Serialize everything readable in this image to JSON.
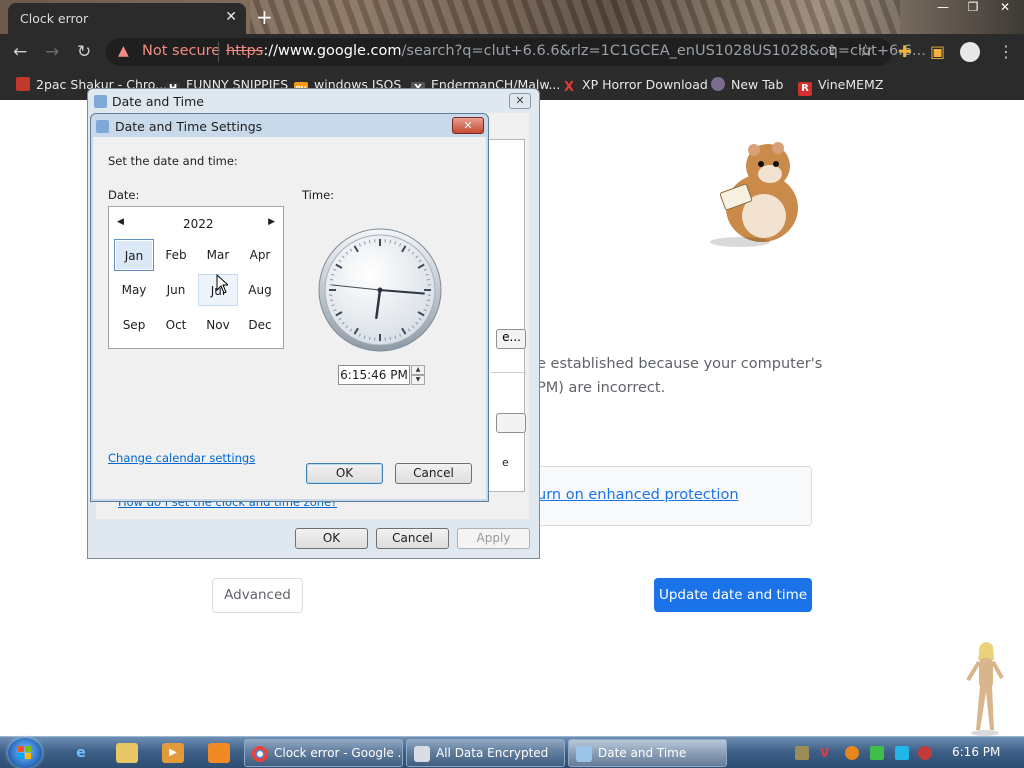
{
  "browser": {
    "tab_title": "Clock error",
    "tab_close": "✕",
    "newtab": "+",
    "window_controls": {
      "minimize": "—",
      "maximize": "❐",
      "close": "✕"
    },
    "security_warning": "Not secure",
    "url": {
      "scheme": "https",
      "host": "://www.google.com",
      "rest": "/search?q=clut+6.6.6&rlz=1C1GCEA_enUS1028US1028&oq=clut+6.6..."
    },
    "bookmarks": [
      {
        "label": "2pac Shakur - Chro...",
        "icon": "suitcase-icon",
        "color": "#c0392b",
        "glyph": ""
      },
      {
        "label": "FUNNY SNIPPIES",
        "icon": "h-icon",
        "color": "#333333",
        "glyph": "H"
      },
      {
        "label": "windows ISOS",
        "icon": "ph-icon",
        "color": "#f39c12",
        "glyph": "PH"
      },
      {
        "label": "EndermanCH/Malw...",
        "icon": "y-icon",
        "color": "#555555",
        "glyph": "Y"
      },
      {
        "label": "XP Horror Download",
        "icon": "x-icon",
        "color": "#e53935",
        "glyph": "X"
      },
      {
        "label": "New Tab",
        "icon": "globe-icon",
        "color": "#7b6b8f",
        "glyph": ""
      },
      {
        "label": "VineMEMZ",
        "icon": "r-icon",
        "color": "#d32f2f",
        "glyph": "R"
      }
    ]
  },
  "page": {
    "error_line1": "e established because your computer's",
    "error_line2": "PM) are incorrect.",
    "protection_link": "urn on enhanced protection",
    "advanced_button": "Advanced",
    "update_button": "Update date and time"
  },
  "outer_dialog": {
    "title": "Date and Time",
    "close": "✕",
    "stub_button_text": "e...",
    "stub_fragment": "e",
    "timezone_link": "How do I set the clock and time zone?",
    "ok": "OK",
    "cancel": "Cancel",
    "apply": "Apply"
  },
  "settings_dialog": {
    "title": "Date and Time Settings",
    "close": "✕",
    "instruction": "Set the date and time:",
    "date_label": "Date:",
    "time_label": "Time:",
    "calendar": {
      "prev": "◀",
      "next": "▶",
      "year": "2022",
      "months": [
        "Jan",
        "Feb",
        "Mar",
        "Apr",
        "May",
        "Jun",
        "Jul",
        "Aug",
        "Sep",
        "Oct",
        "Nov",
        "Dec"
      ],
      "selected": "Jan",
      "hovered": "Jul"
    },
    "clock": {
      "hour": 6,
      "minute": 15,
      "second": 46
    },
    "time_value": "6:15:46 PM",
    "spin_up": "▲",
    "spin_down": "▼",
    "calendar_settings_link": "Change calendar settings",
    "ok": "OK",
    "cancel": "Cancel"
  },
  "taskbar": {
    "buttons": [
      {
        "label": "Clock error - Google ...",
        "icon": "chrome-icon",
        "active": false
      },
      {
        "label": "All Data Encrypted",
        "icon": "window-icon",
        "active": false
      },
      {
        "label": "Date and Time",
        "icon": "calendar-icon",
        "active": true
      }
    ],
    "clock": "6:16 PM"
  }
}
